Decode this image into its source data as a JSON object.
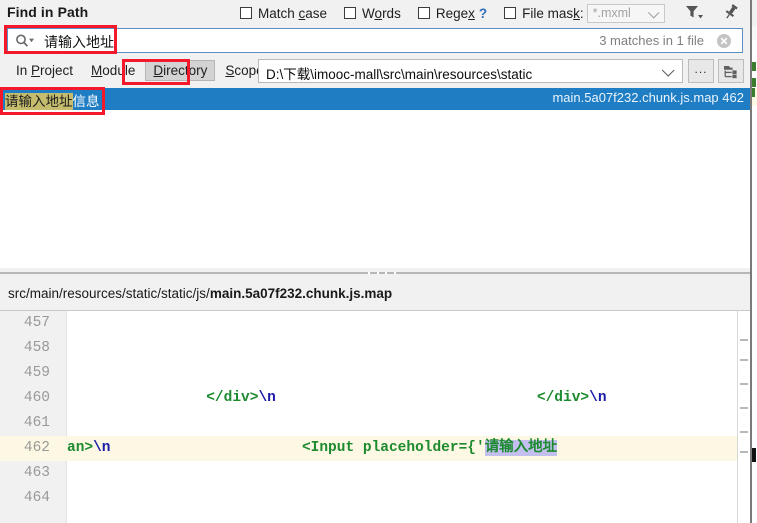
{
  "window": {
    "title": "Find in Path"
  },
  "options": [
    {
      "label_pre": "Match ",
      "label_mn": "c",
      "label_post": "ase",
      "checked": false,
      "name": "match-case"
    },
    {
      "label_pre": "W",
      "label_mn": "o",
      "label_post": "rds",
      "checked": false,
      "name": "words"
    },
    {
      "label_pre": "Rege",
      "label_mn": "x",
      "label_post": "",
      "checked": false,
      "name": "regex",
      "help": "?"
    },
    {
      "label_pre": "File mas",
      "label_mn": "k",
      "label_post": ":",
      "checked": false,
      "name": "file-mask"
    }
  ],
  "file_mask": {
    "value": "*.mxml",
    "enabled": false
  },
  "toolbar": {
    "filter_icon": "filter-icon",
    "pin_icon": "pin-icon"
  },
  "search": {
    "value": "请输入地址",
    "icon": "search-icon",
    "match_count": "3 matches in 1 file",
    "clear_icon": "clear-icon"
  },
  "scope": {
    "tabs": [
      {
        "label_pre": "In ",
        "label_mn": "P",
        "label_post": "roject",
        "name": "in-project",
        "selected": false
      },
      {
        "label_pre": "",
        "label_mn": "M",
        "label_post": "odule",
        "name": "module",
        "selected": false
      },
      {
        "label_pre": "",
        "label_mn": "D",
        "label_post": "irectory",
        "name": "directory",
        "selected": true
      },
      {
        "label_pre": "",
        "label_mn": "S",
        "label_post": "cope",
        "name": "scope",
        "selected": false
      }
    ],
    "path": "D:\\下载\\imooc-mall\\src\\main\\resources\\static",
    "browse_label": "...",
    "tree_icon": "folder-tree-icon"
  },
  "results": [
    {
      "text_before": "",
      "match": "请输入地址",
      "text_after": "信息",
      "file": "main.5a07f232.chunk.js.map",
      "line": "462",
      "selected": true
    }
  ],
  "preview": {
    "path_prefix": "src/main/resources/static/static/js/",
    "file_name": "main.5a07f232.chunk.js.map",
    "lines": [
      {
        "number": "457",
        "highlighted": false,
        "tokens": []
      },
      {
        "number": "458",
        "highlighted": false,
        "tokens": []
      },
      {
        "number": "459",
        "highlighted": false,
        "tokens": []
      },
      {
        "number": "460",
        "highlighted": false,
        "tokens": [
          {
            "text": "                ",
            "style": "plain"
          },
          {
            "text": "</div>",
            "style": "green"
          },
          {
            "text": "\\n",
            "style": "navy"
          },
          {
            "text": "                              ",
            "style": "plain"
          },
          {
            "text": "</div>",
            "style": "green"
          },
          {
            "text": "\\n",
            "style": "navy"
          }
        ]
      },
      {
        "number": "461",
        "highlighted": false,
        "tokens": []
      },
      {
        "number": "462",
        "highlighted": true,
        "tokens": [
          {
            "text": "an>",
            "style": "green"
          },
          {
            "text": "\\n",
            "style": "navy"
          },
          {
            "text": "                      ",
            "style": "plain"
          },
          {
            "text": "<Input placeholder={'",
            "style": "green"
          },
          {
            "text": "请输入地址",
            "style": "selected"
          }
        ]
      },
      {
        "number": "463",
        "highlighted": false,
        "tokens": []
      },
      {
        "number": "464",
        "highlighted": false,
        "tokens": []
      }
    ]
  },
  "annotations": [
    {
      "name": "annotation-search-field",
      "color": "#f4192a"
    },
    {
      "name": "annotation-directory-tab",
      "color": "#f4192a"
    },
    {
      "name": "annotation-result-match",
      "color": "#f4192a"
    }
  ]
}
